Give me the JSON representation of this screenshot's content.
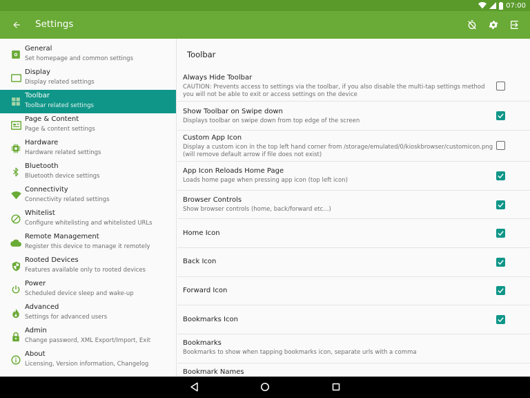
{
  "status_bar": {
    "time": "07:00"
  },
  "app_bar": {
    "title": "Settings"
  },
  "sidebar": {
    "items": [
      {
        "title": "General",
        "subtitle": "Set homepage and common settings",
        "icon": "general-icon"
      },
      {
        "title": "Display",
        "subtitle": "Display related settings",
        "icon": "display-icon"
      },
      {
        "title": "Toolbar",
        "subtitle": "Toolbar related settings",
        "icon": "toolbar-icon",
        "active": true
      },
      {
        "title": "Page & Content",
        "subtitle": "Page & content settings",
        "icon": "page-content-icon"
      },
      {
        "title": "Hardware",
        "subtitle": "Hardware related settings",
        "icon": "chip-icon"
      },
      {
        "title": "Bluetooth",
        "subtitle": "Bluetooth device settings",
        "icon": "bluetooth-icon"
      },
      {
        "title": "Connectivity",
        "subtitle": "Connectivity related settings",
        "icon": "wifi-icon"
      },
      {
        "title": "Whitelist",
        "subtitle": "Configure whitelisting and whitelisted URLs",
        "icon": "block-icon"
      },
      {
        "title": "Remote Management",
        "subtitle": "Register this device to manage it remotely",
        "icon": "cloud-icon"
      },
      {
        "title": "Rooted Devices",
        "subtitle": "Features available only to rooted devices",
        "icon": "shield-icon"
      },
      {
        "title": "Power",
        "subtitle": "Scheduled device sleep and wake-up",
        "icon": "power-icon"
      },
      {
        "title": "Advanced",
        "subtitle": "Settings for advanced users",
        "icon": "flame-icon"
      },
      {
        "title": "Admin",
        "subtitle": "Change password, XML Export/Import, Exit",
        "icon": "lock-icon"
      },
      {
        "title": "About",
        "subtitle": "Licensing, Version information, Changelog",
        "icon": "info-icon"
      }
    ]
  },
  "main": {
    "section_title": "Toolbar",
    "prefs": [
      {
        "title": "Always Hide Toolbar",
        "summary": "CAUTION: Prevents access to settings via the toolbar, if you also disable the multi-tap settings method you will not be able to exit or access settings on the device",
        "checked": false
      },
      {
        "title": "Show Toolbar on Swipe down",
        "summary": "Displays toolbar on swipe down from top edge of the screen",
        "checked": true
      },
      {
        "title": "Custom App Icon",
        "summary": "Display a custom icon in the top left hand corner from /storage/emulated/0/kioskbrowser/customicon.png (will remove default arrow if file does not exist)",
        "checked": false
      },
      {
        "title": "App Icon Reloads Home Page",
        "summary": "Loads home page when pressing app icon (top left icon)",
        "checked": true
      },
      {
        "title": "Browser Controls",
        "summary": "Show browser controls (home, back/forward etc...)",
        "checked": true
      },
      {
        "title": "Home Icon",
        "summary": "",
        "checked": true
      },
      {
        "title": "Back Icon",
        "summary": "",
        "checked": true
      },
      {
        "title": "Forward Icon",
        "summary": "",
        "checked": true
      },
      {
        "title": "Bookmarks Icon",
        "summary": "",
        "checked": true
      },
      {
        "title": "Bookmarks",
        "summary": "Bookmarks to show when tapping bookmarks icon, separate urls with a comma",
        "checked": null
      },
      {
        "title": "Bookmark Names",
        "summary": "",
        "checked": null
      }
    ]
  },
  "colors": {
    "status_bar": "#5a9a2b",
    "app_bar": "#6aaa36",
    "accent": "#0f9688",
    "icon_green": "#6aaa36"
  }
}
